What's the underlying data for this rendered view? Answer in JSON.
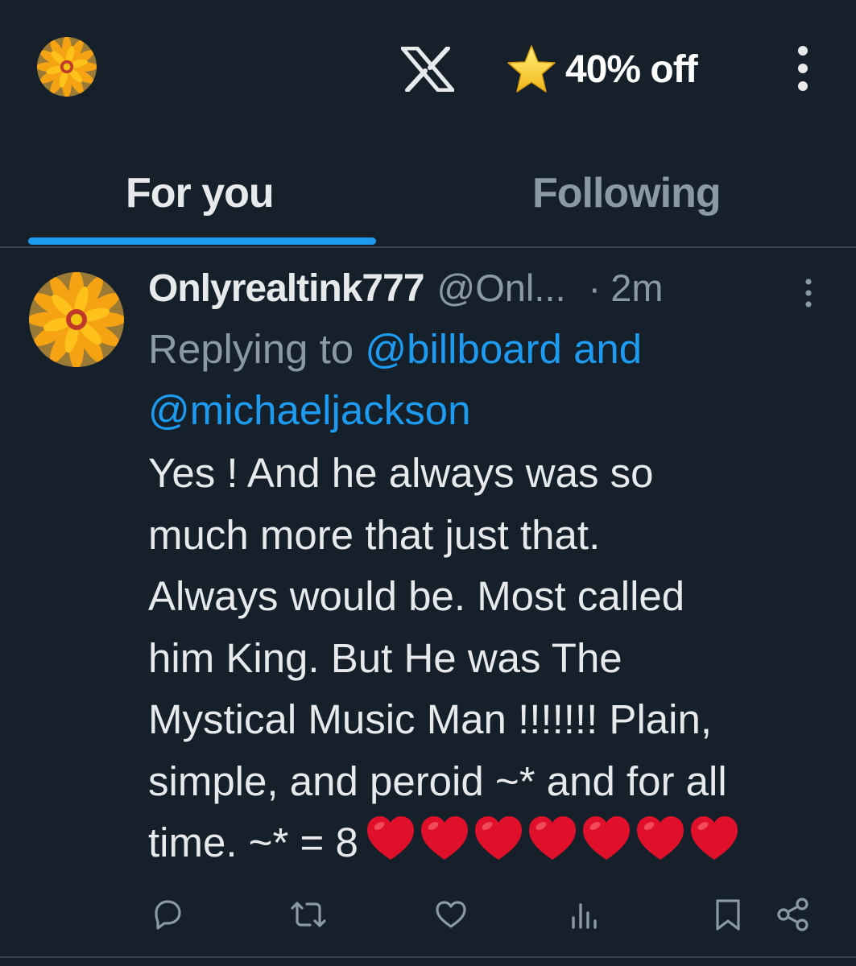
{
  "header": {
    "avatar": "flower-avatar",
    "logo": "x-logo-icon",
    "promo_icon": "star-icon",
    "promo_text": "40% off",
    "more_icon": "more-vertical-icon"
  },
  "tabs": [
    {
      "label": "For you",
      "active": true
    },
    {
      "label": "Following",
      "active": false
    }
  ],
  "tweet": {
    "display_name": "Onlyrealtink777",
    "handle": "@Onl...",
    "separator": "·",
    "time": "2m",
    "replying_prefix": "Replying to",
    "replying_to_1": "@billboard and",
    "replying_to_2": "@michaeljackson",
    "lines": [
      "Yes ! And he always was so",
      "much more that just that.",
      "Always would be. Most called",
      "him King. But He was The",
      "Mystical Music Man !!!!!!! Plain,",
      "simple, and peroid ~* and for all",
      "time. ~* = 8"
    ],
    "heart_count": 7,
    "actions": [
      "reply-icon",
      "retweet-icon",
      "like-icon",
      "views-icon",
      "bookmark-icon",
      "share-icon"
    ]
  },
  "colors": {
    "background": "#15202b",
    "accent": "#1d9bf0",
    "muted": "#8b98a5",
    "heart": "#e0102b"
  }
}
